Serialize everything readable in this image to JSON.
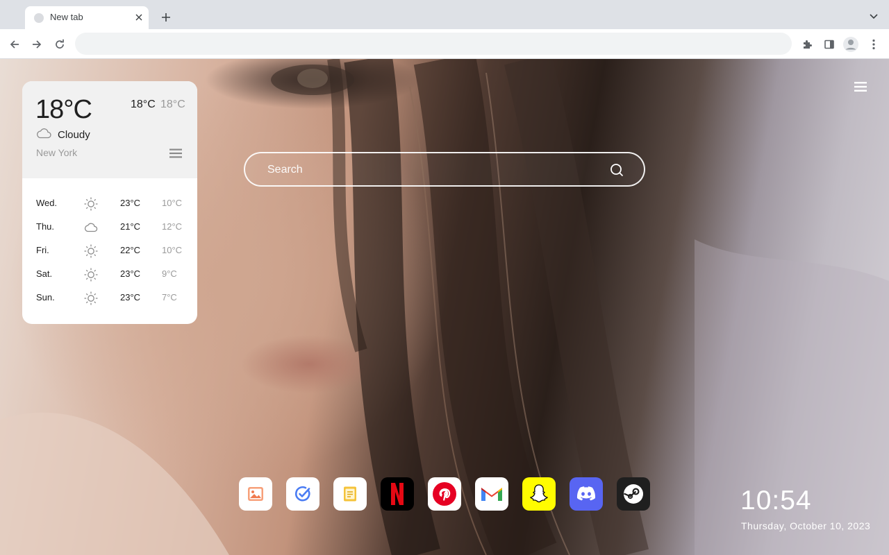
{
  "browser": {
    "tab_title": "New tab",
    "omnibox_value": ""
  },
  "weather": {
    "current_temp": "18°C",
    "today_high": "18°C",
    "today_low": "18°C",
    "condition": "Cloudy",
    "city": "New York",
    "forecast": [
      {
        "day": "Wed.",
        "icon": "sun-icon",
        "high": "23°C",
        "low": "10°C"
      },
      {
        "day": "Thu.",
        "icon": "cloud-icon",
        "high": "21°C",
        "low": "12°C"
      },
      {
        "day": "Fri.",
        "icon": "sun-icon",
        "high": "22°C",
        "low": "10°C"
      },
      {
        "day": "Sat.",
        "icon": "sun-icon",
        "high": "23°C",
        "low": "9°C"
      },
      {
        "day": "Sun.",
        "icon": "sun-icon",
        "high": "23°C",
        "low": "7°C"
      }
    ]
  },
  "search": {
    "placeholder": "Search"
  },
  "dock": [
    {
      "name": "gallery-app",
      "icon": "image-icon",
      "bg": "#ffffff"
    },
    {
      "name": "tasks-app",
      "icon": "check-icon",
      "bg": "#ffffff"
    },
    {
      "name": "notes-app",
      "icon": "note-icon",
      "bg": "#ffffff"
    },
    {
      "name": "netflix-app",
      "icon": "netflix-icon",
      "bg": "#000000"
    },
    {
      "name": "pinterest-app",
      "icon": "pinterest-icon",
      "bg": "#ffffff"
    },
    {
      "name": "gmail-app",
      "icon": "gmail-icon",
      "bg": "#ffffff"
    },
    {
      "name": "snapchat-app",
      "icon": "snapchat-icon",
      "bg": "#fffc00"
    },
    {
      "name": "discord-app",
      "icon": "discord-icon",
      "bg": "#5865f2"
    },
    {
      "name": "steam-app",
      "icon": "steam-icon",
      "bg": "#1f1f1f"
    }
  ],
  "clock": {
    "time": "10:54",
    "date": "Thursday, October 10, 2023"
  }
}
